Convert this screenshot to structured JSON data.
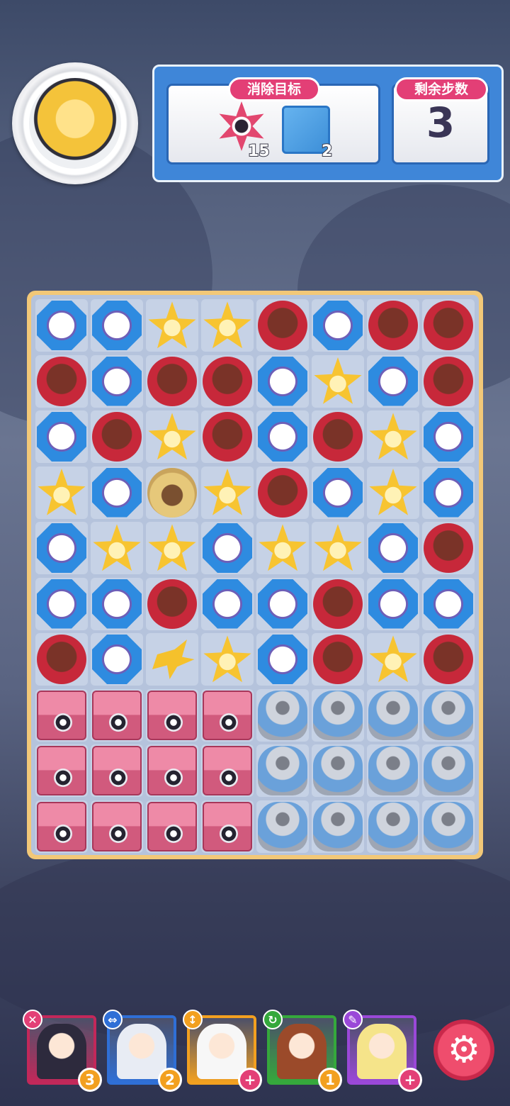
{
  "goal": {
    "label": "消除目标",
    "targets": [
      {
        "icon": "star-badge-icon",
        "count": "15"
      },
      {
        "icon": "ice-block-icon",
        "count": "2"
      }
    ]
  },
  "moves": {
    "label": "剩余步数",
    "value": "3"
  },
  "board": {
    "rows": [
      [
        "blue",
        "blue",
        "yellow",
        "yellow",
        "red",
        "blue",
        "red",
        "red"
      ],
      [
        "red",
        "blue",
        "red",
        "red",
        "blue",
        "yellow",
        "blue",
        "red"
      ],
      [
        "blue",
        "red",
        "yellow",
        "red",
        "blue",
        "red",
        "yellow",
        "blue"
      ],
      [
        "yellow",
        "blue",
        "special",
        "yellow",
        "red",
        "blue",
        "yellow",
        "blue"
      ],
      [
        "blue",
        "yellow",
        "yellow",
        "blue",
        "yellow",
        "yellow",
        "blue",
        "red"
      ],
      [
        "blue",
        "blue",
        "red",
        "blue",
        "blue",
        "red",
        "blue",
        "blue"
      ],
      [
        "red",
        "blue",
        "burst",
        "yellow",
        "blue",
        "red",
        "yellow",
        "red"
      ],
      [
        "crate",
        "crate",
        "crate",
        "crate",
        "pot",
        "pot",
        "pot",
        "pot"
      ],
      [
        "crate",
        "crate",
        "crate",
        "crate",
        "pot",
        "pot",
        "pot",
        "pot"
      ],
      [
        "crate",
        "crate",
        "crate",
        "crate",
        "pot",
        "pot",
        "pot",
        "pot"
      ]
    ]
  },
  "heroes": [
    {
      "name": "hero-1",
      "icon": "close-icon",
      "icon_glyph": "✕",
      "badge": "3",
      "color": "#c2285a",
      "icon_color": "#e33f76",
      "badge_color": "#f2a020",
      "portrait": "#2d2a3d"
    },
    {
      "name": "hero-2",
      "icon": "swap-icon",
      "icon_glyph": "⇔",
      "badge": "2",
      "color": "#2f6fd6",
      "icon_color": "#2f6fd6",
      "badge_color": "#f2a020",
      "portrait": "#e8ecf4"
    },
    {
      "name": "hero-3",
      "icon": "vertical-arrow-icon",
      "icon_glyph": "↕",
      "badge": "+",
      "color": "#f2a020",
      "icon_color": "#f2a020",
      "badge_color": "#e33f76",
      "portrait": "#f7f7f7"
    },
    {
      "name": "hero-4",
      "icon": "refresh-icon",
      "icon_glyph": "↻",
      "badge": "1",
      "color": "#35a83c",
      "icon_color": "#35a83c",
      "badge_color": "#f2a020",
      "portrait": "#9b4a2a"
    },
    {
      "name": "hero-5",
      "icon": "feather-icon",
      "icon_glyph": "✎",
      "badge": "+",
      "color": "#9a48d8",
      "icon_color": "#9a48d8",
      "badge_color": "#e33f76",
      "portrait": "#f5e48a"
    }
  ],
  "settings": {
    "icon": "gear-icon",
    "glyph": "⚙"
  }
}
